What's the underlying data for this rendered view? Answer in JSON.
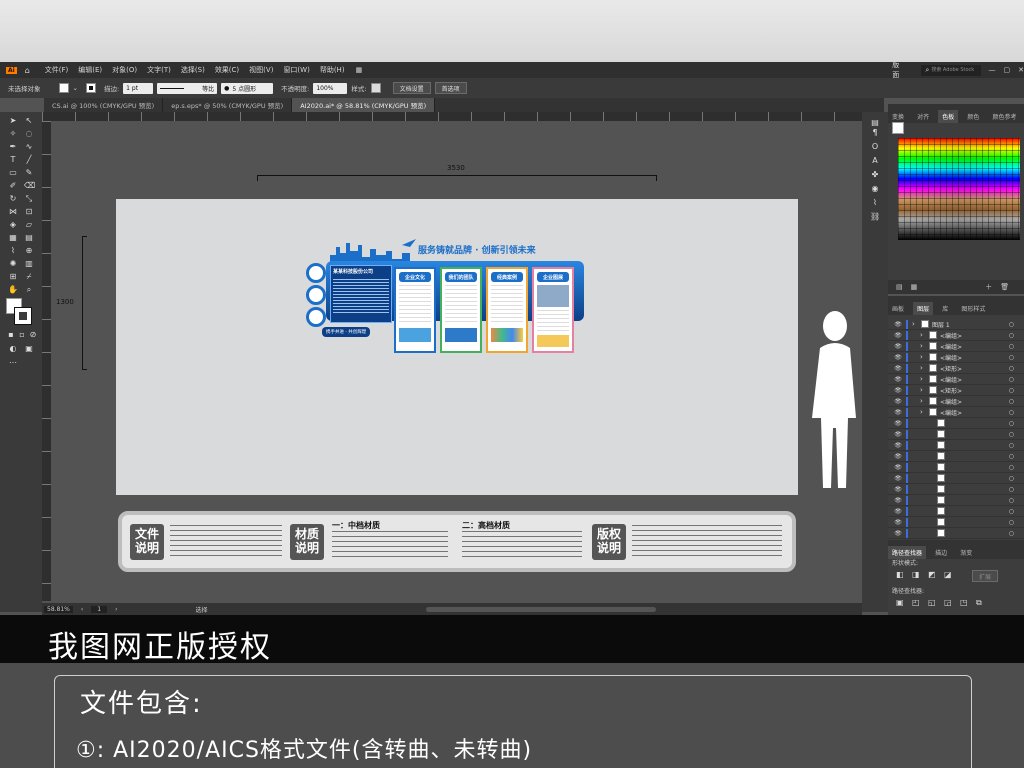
{
  "menu": {
    "app_logo": "Ai",
    "items": [
      "文件(F)",
      "编辑(E)",
      "对象(O)",
      "文字(T)",
      "选择(S)",
      "效果(C)",
      "视图(V)",
      "窗口(W)",
      "帮助(H)"
    ],
    "workspace": "版面",
    "search_placeholder": "搜索 Adobe Stock"
  },
  "control": {
    "selection_label": "未选择对象",
    "stroke_label": "描边:",
    "stroke_value": "1 pt",
    "profile_label": "等比",
    "brush_label": "5 点圆形",
    "opacity_label": "不透明度:",
    "opacity_value": "100%",
    "style_label": "样式:",
    "doc_settings_button": "文档设置",
    "preferences_button": "首选项"
  },
  "tabs": [
    {
      "label": "CS.ai @ 100% (CMYK/GPU 预览)",
      "active": false
    },
    {
      "label": "ep.s.eps* @ 50% (CMYK/GPU 预览)",
      "active": false
    },
    {
      "label": "AI2020.ai* @ 58.81% (CMYK/GPU 预览)",
      "active": true
    }
  ],
  "canvas": {
    "width_dim": "3530",
    "height_dim": "1300",
    "wall_slogan": "服务铸就品牌 · 创新引领未来",
    "company_name": "某某科技股份公司",
    "panel_titles": [
      "企业文化",
      "我们的团队",
      "经典案例",
      "企业图展"
    ],
    "left_banner": "携手并进 · 共创辉煌"
  },
  "info_bar": {
    "box1": "文件说明",
    "box2": "材质说明",
    "box3": "版权说明",
    "head_mid": "一：中档材质",
    "head_high": "二：高档材质"
  },
  "status": {
    "zoom": "58.81%",
    "page": "1",
    "tool": "选择"
  },
  "swatch_panel": {
    "tabs": [
      "变换",
      "对齐",
      "色板",
      "颜色",
      "颜色参考"
    ],
    "active_tab": "色板"
  },
  "layers_panel": {
    "tabs": [
      "画板",
      "图层",
      "库",
      "图形样式"
    ],
    "active_tab": "图层",
    "rows": [
      {
        "label": "图层 1",
        "indent": 0
      },
      {
        "label": "<编组>",
        "indent": 1
      },
      {
        "label": "<编组>",
        "indent": 1
      },
      {
        "label": "<编组>",
        "indent": 1
      },
      {
        "label": "<矩形>",
        "indent": 1
      },
      {
        "label": "<编组>",
        "indent": 1
      },
      {
        "label": "<矩形>",
        "indent": 1
      },
      {
        "label": "<编组>",
        "indent": 1
      },
      {
        "label": "<编组>",
        "indent": 1
      },
      {
        "label": "",
        "indent": 2
      },
      {
        "label": "",
        "indent": 2
      },
      {
        "label": "",
        "indent": 2
      },
      {
        "label": "",
        "indent": 2
      },
      {
        "label": "",
        "indent": 2
      },
      {
        "label": "",
        "indent": 2
      },
      {
        "label": "",
        "indent": 2
      },
      {
        "label": "",
        "indent": 2
      },
      {
        "label": "",
        "indent": 2
      },
      {
        "label": "",
        "indent": 2
      },
      {
        "label": "",
        "indent": 2
      }
    ]
  },
  "path_panel": {
    "tabs": [
      "路径查找器",
      "描边",
      "渐变"
    ],
    "shape_modes": "形状模式:",
    "expand_button": "扩展",
    "pathfinders": "路径查找器:"
  },
  "overlay": {
    "title": "我图网正版授权",
    "files_heading": "文件包含:",
    "files_line": "①: AI2020/AICS格式文件(含转曲、未转曲)"
  },
  "colors": {
    "wall_blue": "#1c6fc9",
    "wall_dark": "#0d3f86"
  }
}
